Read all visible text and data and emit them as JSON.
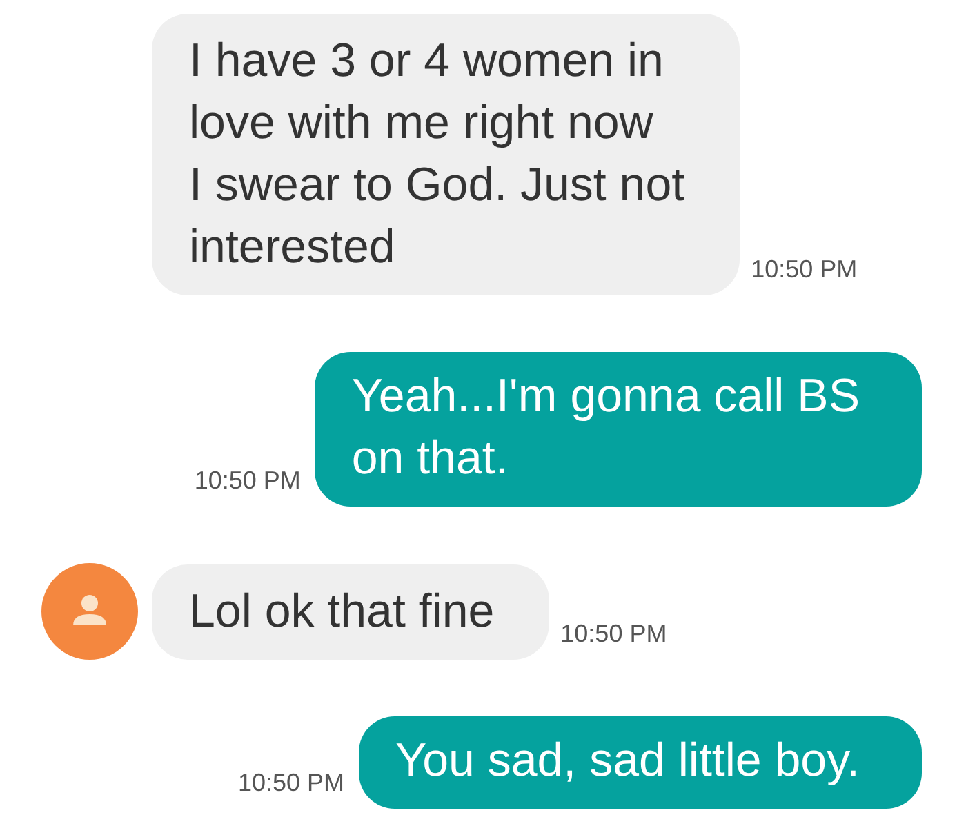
{
  "messages": [
    {
      "kind": "incoming",
      "text": "I have 3 or 4 women in\nlove with me right now\nI swear to God. Just not\ninterested",
      "time": "10:50 PM"
    },
    {
      "kind": "outgoing",
      "text": "Yeah...I'm gonna call BS\non that.",
      "time": "10:50 PM"
    },
    {
      "kind": "incoming",
      "avatar": true,
      "text": "Lol ok that fine",
      "time": "10:50 PM"
    },
    {
      "kind": "outgoing",
      "text": "You sad, sad little boy.",
      "time": "10:50 PM"
    }
  ]
}
